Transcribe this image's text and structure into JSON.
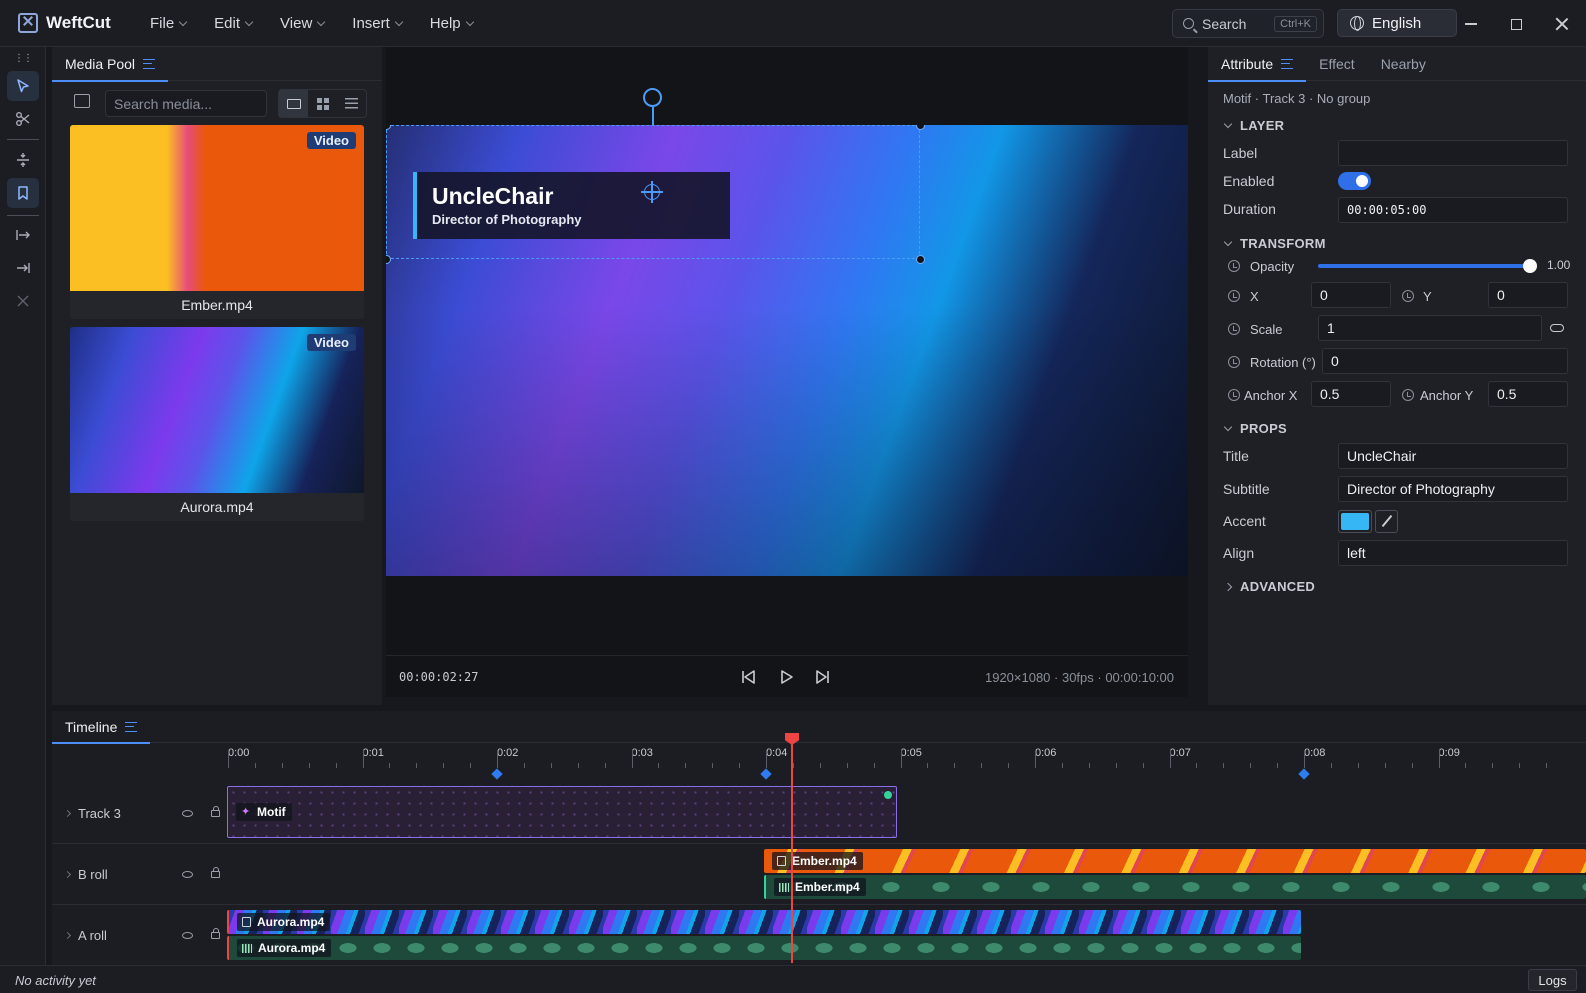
{
  "app": {
    "name": "WeftCut",
    "menu": [
      "File",
      "Edit",
      "View",
      "Insert",
      "Help"
    ],
    "search_label": "Search",
    "search_shortcut": "Ctrl+K",
    "language": "English"
  },
  "media_pool": {
    "tab": "Media Pool",
    "search_placeholder": "Search media...",
    "items": [
      {
        "name": "Ember.mp4",
        "badge": "Video"
      },
      {
        "name": "Aurora.mp4",
        "badge": "Video"
      }
    ]
  },
  "viewer": {
    "timecode": "00:00:02:27",
    "meta": "1920×1080 · 30fps · 00:00:10:00",
    "overlay_title": "UncleChair",
    "overlay_subtitle": "Director of Photography"
  },
  "inspector": {
    "tabs": [
      "Attribute",
      "Effect",
      "Nearby"
    ],
    "breadcrumb": "Motif · Track 3 · No group",
    "sections": {
      "layer": "LAYER",
      "transform": "TRANSFORM",
      "props": "PROPS",
      "advanced": "ADVANCED"
    },
    "layer": {
      "label_label": "Label",
      "label_value": "",
      "enabled_label": "Enabled",
      "enabled": true,
      "duration_label": "Duration",
      "duration_value": "00:00:05:00"
    },
    "transform": {
      "opacity_label": "Opacity",
      "opacity_value": "1.00",
      "opacity": 1.0,
      "x_label": "X",
      "x_value": "0",
      "y_label": "Y",
      "y_value": "0",
      "scale_label": "Scale",
      "scale_value": "1",
      "rotation_label": "Rotation (°)",
      "rotation_value": "0",
      "anchor_x_label": "Anchor X",
      "anchor_x_value": "0.5",
      "anchor_y_label": "Anchor Y",
      "anchor_y_value": "0.5"
    },
    "props": {
      "title_label": "Title",
      "title_value": "UncleChair",
      "subtitle_label": "Subtitle",
      "subtitle_value": "Director of Photography",
      "accent_label": "Accent",
      "accent_color": "#36b6f4",
      "align_label": "Align",
      "align_value": "left"
    }
  },
  "timeline": {
    "tab": "Timeline",
    "ticks": [
      "0:00",
      "0:01",
      "0:02",
      "0:03",
      "0:04",
      "0:05",
      "0:06",
      "0:07",
      "0:08",
      "0:09"
    ],
    "tracks": [
      {
        "name": "Track 3"
      },
      {
        "name": "B roll"
      },
      {
        "name": "A roll"
      }
    ],
    "clips": {
      "motif": "Motif",
      "ember_video": "Ember.mp4",
      "ember_audio": "Ember.mp4",
      "aurora_video": "Aurora.mp4",
      "aurora_audio": "Aurora.mp4"
    }
  },
  "status": {
    "text": "No activity yet",
    "logs": "Logs"
  }
}
